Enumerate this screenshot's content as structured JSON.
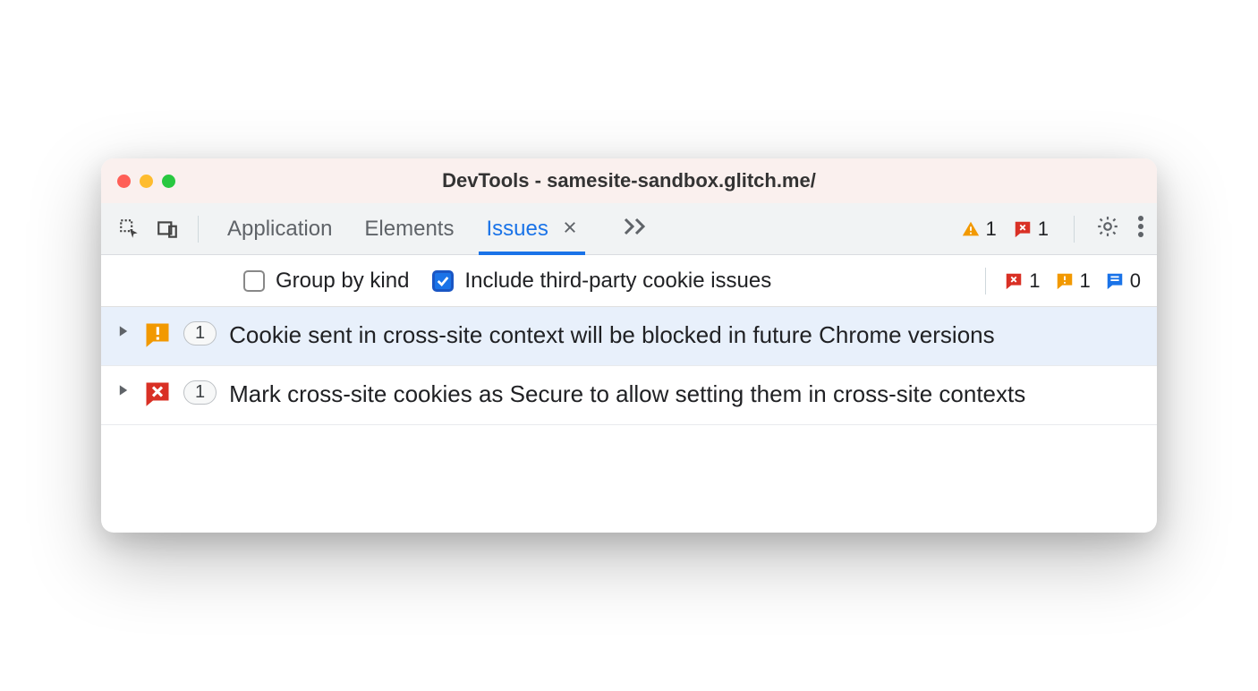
{
  "window": {
    "title": "DevTools - samesite-sandbox.glitch.me/"
  },
  "tabs": {
    "application": "Application",
    "elements": "Elements",
    "issues": "Issues"
  },
  "toolbarCounters": {
    "warnings": "1",
    "errors": "1"
  },
  "filters": {
    "groupByKind": "Group by kind",
    "includeThirdParty": "Include third-party cookie issues"
  },
  "filterCounters": {
    "errors": "1",
    "warnings": "1",
    "info": "0"
  },
  "issues": [
    {
      "count": "1",
      "title": "Cookie sent in cross-site context will be blocked in future Chrome versions"
    },
    {
      "count": "1",
      "title": "Mark cross-site cookies as Secure to allow setting them in cross-site contexts"
    }
  ]
}
